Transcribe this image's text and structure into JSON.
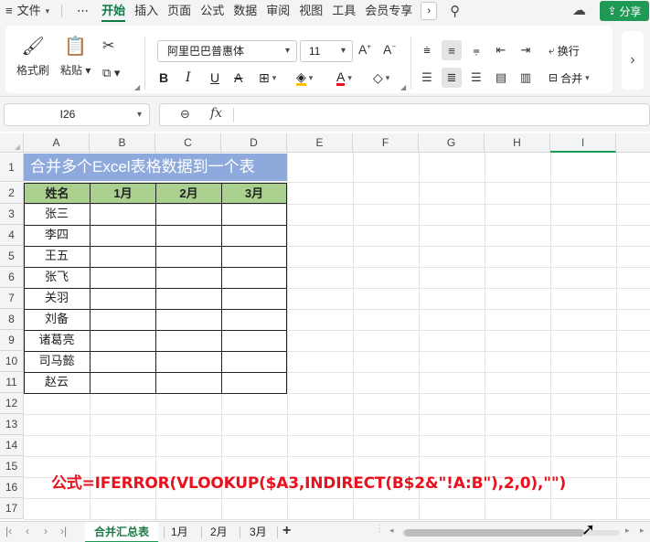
{
  "menubar": {
    "file": "文件",
    "more_dots": "⋯",
    "tabs": [
      "开始",
      "插入",
      "页面",
      "公式",
      "数据",
      "审阅",
      "视图",
      "工具",
      "会员专享"
    ],
    "active_tab": "开始",
    "share": "分享"
  },
  "ribbon": {
    "format_painter": "格式刷",
    "paste": "粘贴",
    "font_name": "阿里巴巴普惠体",
    "font_size": "11",
    "wrap": "换行",
    "merge": "合并",
    "accent_color": "#1e9a55",
    "font_color": "#e8121e",
    "fill_color": "#ffc000"
  },
  "formula_bar": {
    "name_box": "I26",
    "fx": "fx",
    "content": ""
  },
  "grid": {
    "columns": [
      "A",
      "B",
      "C",
      "D",
      "E",
      "F",
      "G",
      "H",
      "I"
    ],
    "active_column": "I",
    "rows": [
      "1",
      "2",
      "3",
      "4",
      "5",
      "6",
      "7",
      "8",
      "9",
      "10",
      "11",
      "12",
      "13",
      "14",
      "15",
      "16",
      "17"
    ],
    "title": "合并多个Excel表格数据到一个表",
    "headers": [
      "姓名",
      "1月",
      "2月",
      "3月"
    ],
    "names": [
      "张三",
      "李四",
      "王五",
      "张飞",
      "关羽",
      "刘备",
      "诸葛亮",
      "司马懿",
      "赵云"
    ],
    "formula_note": "公式=IFERROR(VLOOKUP($A3,INDIRECT(B$2&\"!A:B\"),2,0),\"\")",
    "title_bg": "#8ea9db",
    "header_bg": "#a9d08e"
  },
  "sheets": {
    "tabs": [
      "合并汇总表",
      "1月",
      "2月",
      "3月"
    ],
    "active": "合并汇总表",
    "add": "+"
  }
}
